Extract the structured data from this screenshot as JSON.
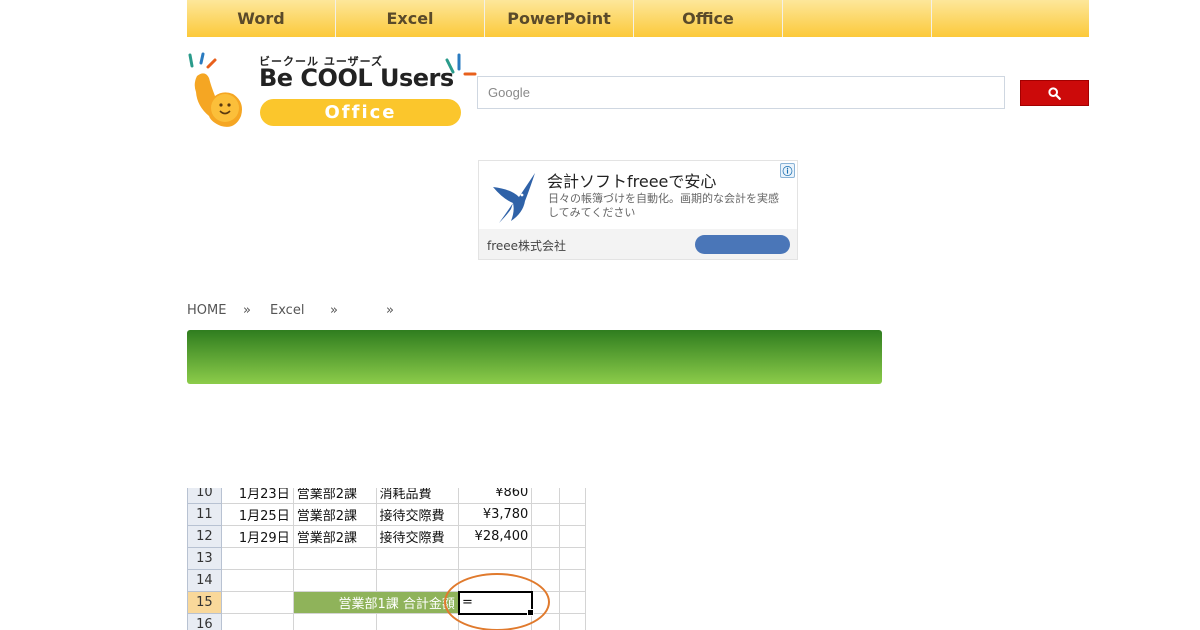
{
  "nav": {
    "items": [
      {
        "label": "Word"
      },
      {
        "label": "Excel"
      },
      {
        "label": "PowerPoint"
      },
      {
        "label": "Office"
      },
      {
        "label": ""
      },
      {
        "label": ""
      }
    ]
  },
  "logo": {
    "kana": "ビークール ユーザーズ",
    "title": "Be COOL Users",
    "badge": "Office"
  },
  "search": {
    "placeholder": "Google",
    "button_icon": "search-icon"
  },
  "ad": {
    "title": "会計ソフトfreeeで安心",
    "description": "日々の帳簿づけを自動化。画期的な会計を実感してみてください",
    "company": "freee株式会社",
    "info_icon": "ⓘ"
  },
  "breadcrumb": {
    "home": "HOME",
    "sep": "»",
    "excel": "Excel"
  },
  "colors": {
    "nav_gradient_top": "#fde79a",
    "nav_gradient_bottom": "#fcc93a",
    "search_button": "#cc0a0a",
    "banner_top": "#2f7d1f",
    "banner_bottom": "#8ccc4a",
    "label_cell": "#8fb35a",
    "highlight_circle": "#e07a2d"
  },
  "sheet": {
    "rows": [
      {
        "num": "10",
        "date": "1月23日",
        "dept": "営業部2課",
        "item": "消耗品費",
        "amount": "¥860"
      },
      {
        "num": "11",
        "date": "1月25日",
        "dept": "営業部2課",
        "item": "接待交際費",
        "amount": "¥3,780"
      },
      {
        "num": "12",
        "date": "1月29日",
        "dept": "営業部2課",
        "item": "接待交際費",
        "amount": "¥28,400"
      },
      {
        "num": "13",
        "date": "",
        "dept": "",
        "item": "",
        "amount": ""
      },
      {
        "num": "14",
        "date": "",
        "dept": "",
        "item": "",
        "amount": ""
      },
      {
        "num": "15",
        "label": "営業部1課 合計金額",
        "input": "="
      },
      {
        "num": "16"
      }
    ]
  }
}
